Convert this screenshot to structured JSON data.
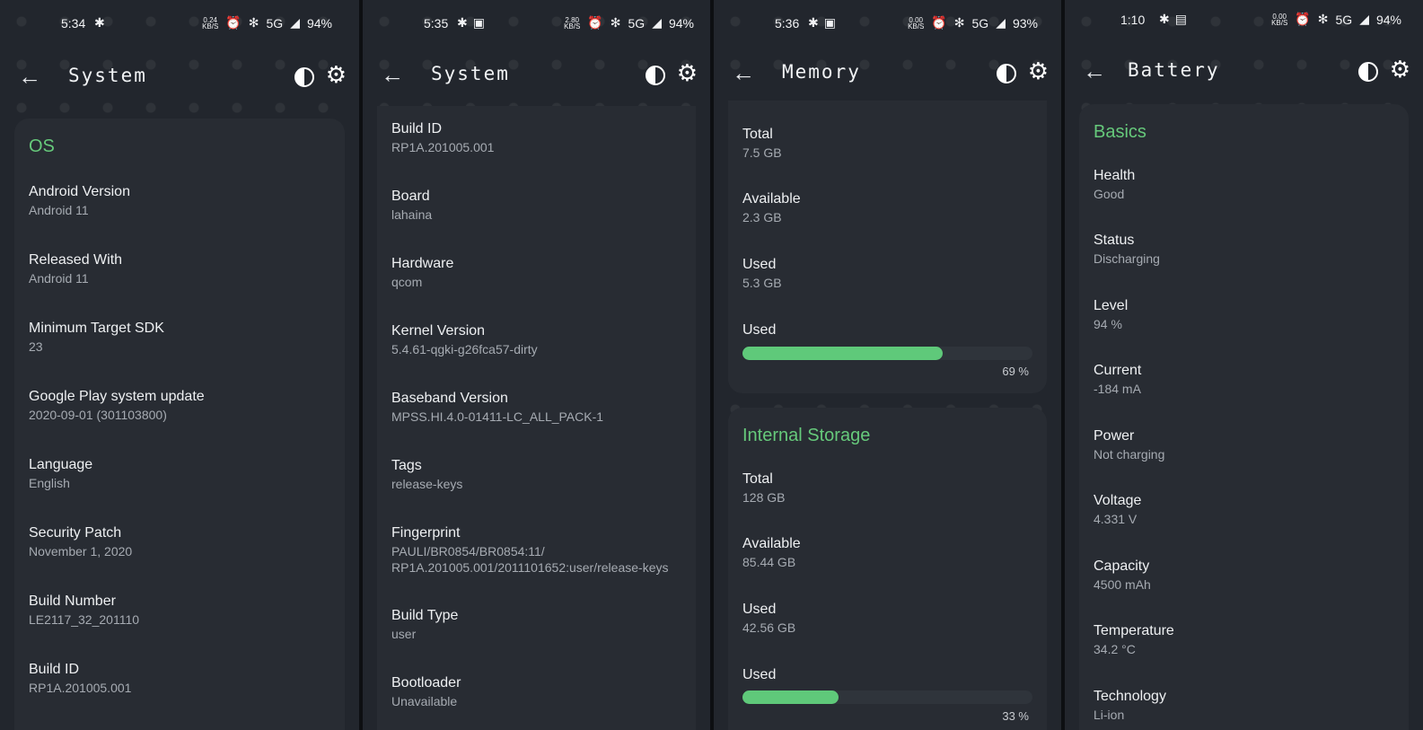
{
  "screens": [
    {
      "status": {
        "time": "5:34",
        "kbs": "0.24",
        "kbs_unit": "KB/S",
        "network": "5G",
        "battery": "94%"
      },
      "title": "System",
      "section": "OS",
      "items": [
        {
          "label": "Android Version",
          "value": "Android 11"
        },
        {
          "label": "Released With",
          "value": "Android 11"
        },
        {
          "label": "Minimum Target SDK",
          "value": "23"
        },
        {
          "label": "Google Play system update",
          "value": "2020-09-01 (301103800)"
        },
        {
          "label": "Language",
          "value": "English"
        },
        {
          "label": "Security Patch",
          "value": "November 1, 2020"
        },
        {
          "label": "Build Number",
          "value": "LE2117_32_201110"
        },
        {
          "label": "Build ID",
          "value": "RP1A.201005.001"
        }
      ]
    },
    {
      "status": {
        "time": "5:35",
        "kbs": "2.80",
        "kbs_unit": "KB/S",
        "network": "5G",
        "battery": "94%"
      },
      "title": "System",
      "items": [
        {
          "label": "Build ID",
          "value": "RP1A.201005.001"
        },
        {
          "label": "Board",
          "value": "lahaina"
        },
        {
          "label": "Hardware",
          "value": "qcom"
        },
        {
          "label": "Kernel Version",
          "value": "5.4.61-qgki-g26fca57-dirty"
        },
        {
          "label": "Baseband Version",
          "value": "MPSS.HI.4.0-01411-LC_ALL_PACK-1"
        },
        {
          "label": "Tags",
          "value": "release-keys"
        },
        {
          "label": "Fingerprint",
          "value": "PAULI/BR0854/BR0854:11/",
          "value2": "RP1A.201005.001/2011101652:user/release-keys"
        },
        {
          "label": "Build Type",
          "value": "user"
        },
        {
          "label": "Bootloader",
          "value": "Unavailable"
        }
      ]
    },
    {
      "status": {
        "time": "5:36",
        "kbs": "0.00",
        "kbs_unit": "KB/S",
        "network": "5G",
        "battery": "93%"
      },
      "title": "Memory",
      "memory": [
        {
          "label": "Total",
          "value": "7.5 GB"
        },
        {
          "label": "Available",
          "value": "2.3 GB"
        },
        {
          "label": "Used",
          "value": "5.3 GB"
        }
      ],
      "memory_used_label": "Used",
      "memory_used_pct": "69 %",
      "memory_used_fraction": 0.69,
      "storage_title": "Internal Storage",
      "storage": [
        {
          "label": "Total",
          "value": "128 GB"
        },
        {
          "label": "Available",
          "value": "85.44 GB"
        },
        {
          "label": "Used",
          "value": "42.56 GB"
        }
      ],
      "storage_used_label": "Used",
      "storage_used_pct": "33 %",
      "storage_used_fraction": 0.33
    },
    {
      "status": {
        "time": "1:10",
        "kbs": "0.00",
        "kbs_unit": "KB/S",
        "network": "5G",
        "battery": "94%"
      },
      "title": "Battery",
      "section": "Basics",
      "items": [
        {
          "label": "Health",
          "value": "Good"
        },
        {
          "label": "Status",
          "value": "Discharging"
        },
        {
          "label": "Level",
          "value": "94 %"
        },
        {
          "label": "Current",
          "value": "-184 mA"
        },
        {
          "label": "Power",
          "value": "Not charging"
        },
        {
          "label": "Voltage",
          "value": "4.331 V"
        },
        {
          "label": "Capacity",
          "value": "4500 mAh"
        },
        {
          "label": "Temperature",
          "value": "34.2 °C"
        },
        {
          "label": "Technology",
          "value": "Li-ion"
        }
      ]
    }
  ],
  "icons": {
    "back": "arrow-left-icon",
    "theme": "contrast-icon",
    "settings": "gear-icon",
    "alarm": "alarm-icon",
    "bluetooth": "bluetooth-icon",
    "signal": "signal-icon",
    "image": "image-icon",
    "notification": "notification-icon"
  },
  "colors": {
    "accent": "#66c97b",
    "background": "#22262d",
    "card": "#282c33",
    "bar_fill": "#5fc97a"
  }
}
